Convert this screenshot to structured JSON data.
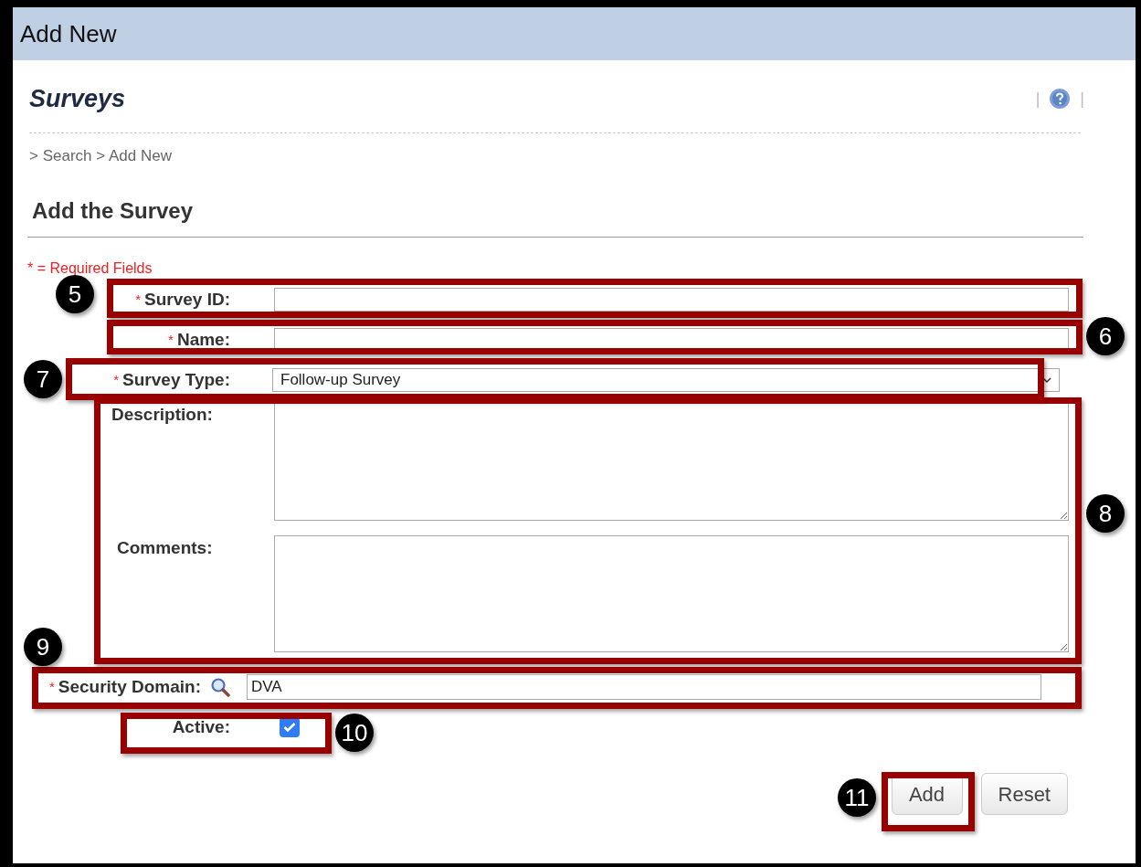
{
  "header": {
    "title": "Add New"
  },
  "page": {
    "title": "Surveys",
    "separators": [
      "|",
      "|"
    ],
    "breadcrumb": "> Search > Add New"
  },
  "section": {
    "title": "Add the Survey",
    "required_note": "* = Required Fields"
  },
  "fields": [
    {
      "kind": "text",
      "label": "Survey ID:",
      "required_mark": "*"
    },
    {
      "kind": "text",
      "label": "Name:",
      "required_mark": "*"
    },
    {
      "kind": "select",
      "label": "Survey Type:",
      "required_mark": "*",
      "value": "Follow-up Survey"
    },
    {
      "kind": "textarea",
      "label": "Description:"
    },
    {
      "kind": "textarea",
      "label": "Comments:"
    },
    {
      "kind": "lookup",
      "label": "Security Domain:",
      "required_mark": "*",
      "value": "DVA"
    },
    {
      "kind": "checkbox",
      "label": "Active:",
      "checked": true
    }
  ],
  "buttons": [
    {
      "label": "Add"
    },
    {
      "label": "Reset"
    }
  ],
  "callouts": [
    {
      "number": "5"
    },
    {
      "number": "6"
    },
    {
      "number": "7"
    },
    {
      "number": "8"
    },
    {
      "number": "9"
    },
    {
      "number": "10"
    },
    {
      "number": "11"
    }
  ]
}
